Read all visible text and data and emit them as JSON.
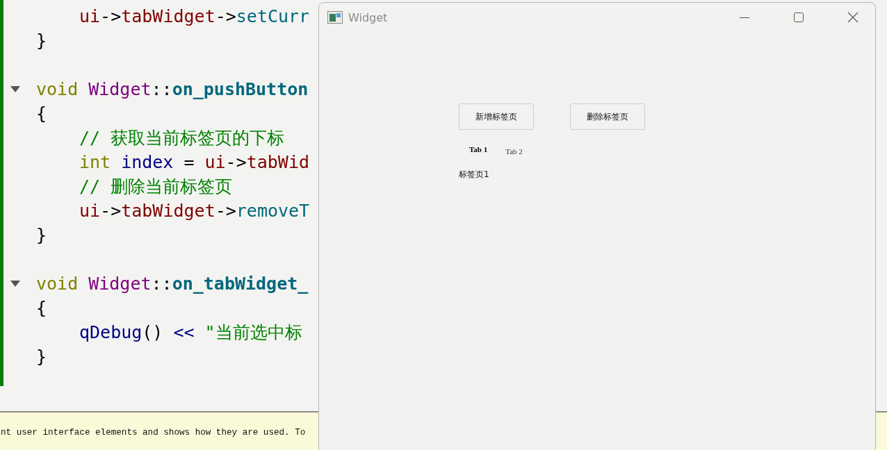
{
  "editor": {
    "lines": [
      {
        "kind": "inner",
        "words": [
          [
            {
              "text": "ui",
              "kind": "member"
            },
            {
              "text": "->",
              "kind": "operator"
            },
            {
              "text": "tabWidget",
              "kind": "member"
            },
            {
              "text": "->",
              "kind": "operator"
            },
            {
              "text": "setCurr",
              "kind": "method"
            }
          ]
        ]
      },
      {
        "kind": "top",
        "words": [
          [
            {
              "text": "}",
              "kind": "plain"
            }
          ]
        ]
      },
      {
        "kind": "blank"
      },
      {
        "kind": "top",
        "expanded": true,
        "words": [
          [
            {
              "text": "void",
              "kind": "keyword"
            }
          ],
          [
            {
              "text": "Widget",
              "kind": "class"
            },
            {
              "text": "::",
              "kind": "operator"
            },
            {
              "text": "on_pushButton",
              "kind": "function"
            }
          ]
        ]
      },
      {
        "kind": "top",
        "words": [
          [
            {
              "text": "{",
              "kind": "plain"
            }
          ]
        ]
      },
      {
        "kind": "inner",
        "words": [
          [
            {
              "text": "// 获取当前标签页的下标",
              "kind": "comment"
            }
          ]
        ]
      },
      {
        "kind": "inner",
        "words": [
          [
            {
              "text": "int",
              "kind": "keyword"
            }
          ],
          [
            {
              "text": "index",
              "kind": "local"
            }
          ],
          [
            {
              "text": "=",
              "kind": "plain"
            }
          ],
          [
            {
              "text": "ui",
              "kind": "member"
            },
            {
              "text": "->",
              "kind": "operator"
            },
            {
              "text": "tabWid",
              "kind": "member"
            }
          ]
        ]
      },
      {
        "kind": "inner",
        "words": [
          [
            {
              "text": "// 删除当前标签页",
              "kind": "comment"
            }
          ]
        ]
      },
      {
        "kind": "inner",
        "words": [
          [
            {
              "text": "ui",
              "kind": "member"
            },
            {
              "text": "->",
              "kind": "operator"
            },
            {
              "text": "tabWidget",
              "kind": "member"
            },
            {
              "text": "->",
              "kind": "operator"
            },
            {
              "text": "removeT",
              "kind": "method"
            }
          ]
        ]
      },
      {
        "kind": "top",
        "words": [
          [
            {
              "text": "}",
              "kind": "plain"
            }
          ]
        ]
      },
      {
        "kind": "blank"
      },
      {
        "kind": "top",
        "expanded": true,
        "words": [
          [
            {
              "text": "void",
              "kind": "keyword"
            }
          ],
          [
            {
              "text": "Widget",
              "kind": "class"
            },
            {
              "text": "::",
              "kind": "operator"
            },
            {
              "text": "on_tabWidget_",
              "kind": "function"
            }
          ]
        ]
      },
      {
        "kind": "top",
        "words": [
          [
            {
              "text": "{",
              "kind": "plain"
            }
          ]
        ]
      },
      {
        "kind": "inner",
        "words": [
          [
            {
              "text": "qDebug",
              "kind": "call"
            },
            {
              "text": "()",
              "kind": "plain"
            }
          ],
          [
            {
              "text": "<<",
              "kind": "call"
            }
          ],
          [
            {
              "text": "\"当前选中标",
              "kind": "string"
            }
          ]
        ]
      },
      {
        "kind": "top",
        "words": [
          [
            {
              "text": "}",
              "kind": "plain"
            }
          ]
        ]
      }
    ]
  },
  "output_pane": {
    "text": "nt user interface elements and shows how they are used. To"
  },
  "window": {
    "title": "Widget",
    "buttons": [
      {
        "label": "新增标签页"
      },
      {
        "label": "删除标签页"
      }
    ],
    "tabs": [
      {
        "label": "Tab 1",
        "selected": true
      },
      {
        "label": "Tab 2",
        "selected": false
      }
    ],
    "tab_content": {
      "label": "标签页1"
    }
  }
}
